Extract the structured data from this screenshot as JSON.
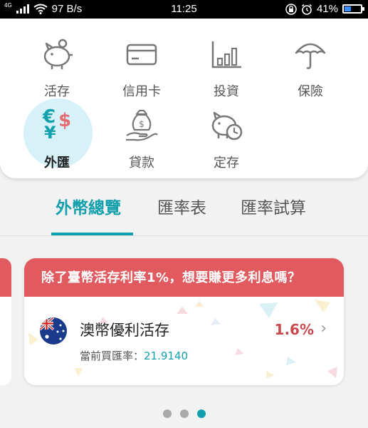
{
  "status_bar": {
    "network": "4G",
    "speed": "97 B/s",
    "time": "11:25",
    "battery": "41%",
    "battery_level": 0.41
  },
  "menu": {
    "items": [
      {
        "label": "活存",
        "icon": "piggy-bank-icon"
      },
      {
        "label": "信用卡",
        "icon": "credit-card-icon"
      },
      {
        "label": "投資",
        "icon": "bar-chart-icon"
      },
      {
        "label": "保險",
        "icon": "umbrella-icon"
      },
      {
        "label": "外匯",
        "icon": "currency-exchange-icon",
        "active": true
      },
      {
        "label": "貸款",
        "icon": "money-bag-hand-icon"
      },
      {
        "label": "定存",
        "icon": "piggy-clock-icon"
      }
    ]
  },
  "tabs": [
    {
      "label": "外幣總覽",
      "selected": true
    },
    {
      "label": "匯率表"
    },
    {
      "label": "匯率試算"
    }
  ],
  "promo": {
    "header": "除了臺幣活存利率1%，想要賺更多利息嗎？",
    "title": "澳幣優利活存",
    "rate": "1.6%",
    "sub_label": "當前買匯率：",
    "sub_value": "21.9140",
    "flag": "australia-flag-icon"
  },
  "pager": {
    "pages": 3,
    "current": 3
  },
  "colors": {
    "accent": "#12a0ad",
    "promo_red": "#e05a5f",
    "rate_red": "#c9484d"
  }
}
